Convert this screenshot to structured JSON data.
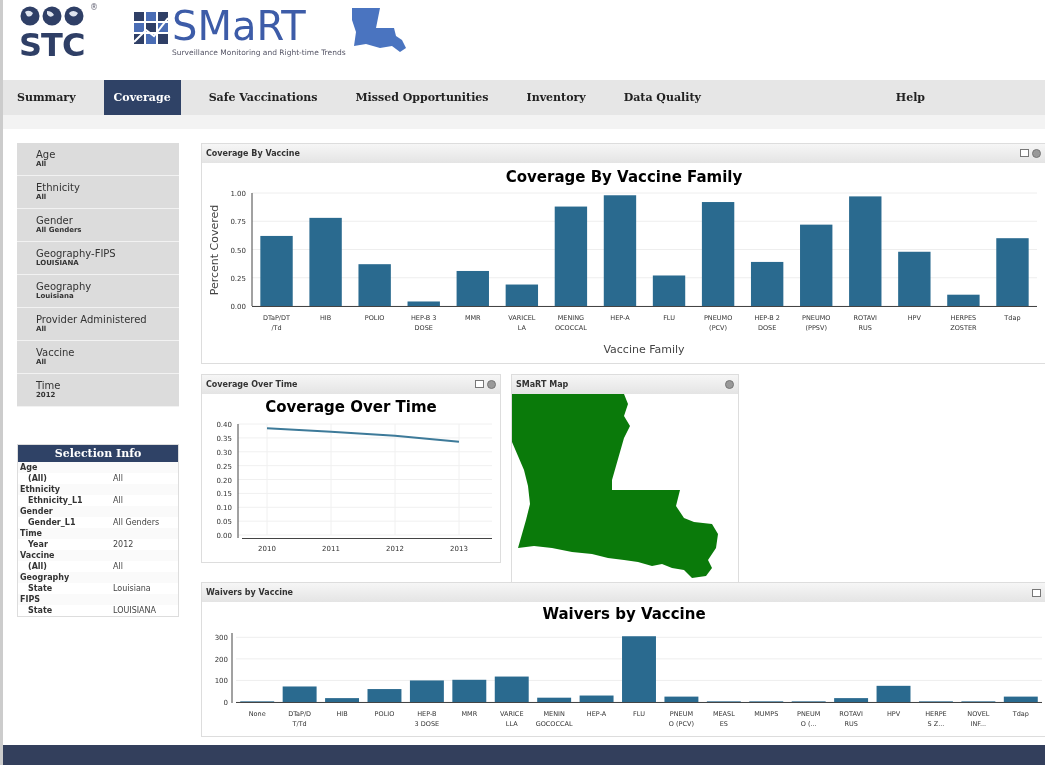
{
  "header": {
    "stc_logo": "STC",
    "registered_mark": "®",
    "smart_logo": "SMaRT",
    "tagline": "Surveillance Monitoring and Right-time Trends"
  },
  "nav": [
    {
      "label": "Summary",
      "selected": false
    },
    {
      "label": "Coverage",
      "selected": true
    },
    {
      "label": "Safe Vaccinations",
      "selected": false
    },
    {
      "label": "Missed Opportunities",
      "selected": false
    },
    {
      "label": "Inventory",
      "selected": false
    },
    {
      "label": "Data Quality",
      "selected": false
    },
    {
      "label": "Help",
      "selected": false
    }
  ],
  "filters": [
    {
      "label": "Age",
      "value": "All"
    },
    {
      "label": "Ethnicity",
      "value": "All"
    },
    {
      "label": "Gender",
      "value": "All Genders"
    },
    {
      "label": "Geography-FIPS",
      "value": "LOUISIANA"
    },
    {
      "label": "Geography",
      "value": "Louisiana"
    },
    {
      "label": "Provider Administered",
      "value": "All"
    },
    {
      "label": "Vaccine",
      "value": "All"
    },
    {
      "label": "Time",
      "value": "2012"
    }
  ],
  "selection_info": {
    "title": "Selection Info",
    "groups": [
      {
        "name": "Age",
        "rows": [
          {
            "key": "(All)",
            "value": "All"
          }
        ]
      },
      {
        "name": "Ethnicity",
        "rows": [
          {
            "key": "Ethnicity_L1",
            "value": "All"
          }
        ]
      },
      {
        "name": "Gender",
        "rows": [
          {
            "key": "Gender_L1",
            "value": "All Genders"
          }
        ]
      },
      {
        "name": "Time",
        "rows": [
          {
            "key": "Year",
            "value": "2012"
          }
        ]
      },
      {
        "name": "Vaccine",
        "rows": [
          {
            "key": "(All)",
            "value": "All"
          }
        ]
      },
      {
        "name": "Geography",
        "rows": [
          {
            "key": "State",
            "value": "Louisiana"
          }
        ]
      },
      {
        "name": "FIPS",
        "rows": [
          {
            "key": "State",
            "value": "LOUISIANA"
          }
        ]
      }
    ]
  },
  "coverage_panel": {
    "title": "Coverage By Vaccine",
    "chart_data": {
      "type": "bar",
      "title": "Coverage By Vaccine Family",
      "xlabel": "Vaccine Family",
      "ylabel": "Percent Covered",
      "categories": [
        "DTaP/DT\n/Td",
        "HIB",
        "POLIO",
        "HEP-B 3\nDOSE",
        "MMR",
        "VARICEL\nLA",
        "MENING\nOCOCCAL",
        "HEP-A",
        "FLU",
        "PNEUMO\n(PCV)",
        "HEP-B 2\nDOSE",
        "PNEUMO\n(PPSV)",
        "ROTAVI\nRUS",
        "HPV",
        "HERPES\nZOSTER",
        "Tdap"
      ],
      "grid": true,
      "series": [
        {
          "color": "#2a6a8f",
          "values": [
            0.62,
            0.78,
            0.37,
            0.04,
            0.31,
            0.19,
            0.88,
            0.98,
            0.27,
            0.92,
            0.39,
            0.72,
            0.97,
            0.48,
            0.1,
            0.6
          ]
        }
      ],
      "ylim": [
        0,
        1
      ],
      "yticks": [
        {
          "value": 0,
          "label": "0.00"
        },
        {
          "value": 0.25,
          "label": "0.25"
        },
        {
          "value": 0.5,
          "label": "0.50"
        },
        {
          "value": 0.75,
          "label": "0.75"
        },
        {
          "value": 1,
          "label": "1.00"
        }
      ]
    }
  },
  "time_panel": {
    "title": "Coverage Over Time",
    "chart_data": {
      "type": "line",
      "title": "Coverage Over Time",
      "x": [
        "2010",
        "2011",
        "2012",
        "2013"
      ],
      "grid": true,
      "series": [
        {
          "color": "#3d7a99",
          "values": [
            0.385,
            0.372,
            0.358,
            0.336
          ]
        }
      ],
      "ylim": [
        0,
        0.4
      ],
      "yticks": [
        {
          "value": 0,
          "label": "0.00"
        },
        {
          "value": 0.05,
          "label": "0.05"
        },
        {
          "value": 0.1,
          "label": "0.10"
        },
        {
          "value": 0.15,
          "label": "0.15"
        },
        {
          "value": 0.2,
          "label": "0.20"
        },
        {
          "value": 0.25,
          "label": "0.25"
        },
        {
          "value": 0.3,
          "label": "0.30"
        },
        {
          "value": 0.35,
          "label": "0.35"
        },
        {
          "value": 0.4,
          "label": "0.40"
        }
      ]
    }
  },
  "map_panel": {
    "title": "SMaRT Map"
  },
  "waivers_panel": {
    "title": "Waivers by Vaccine",
    "chart_data": {
      "type": "bar",
      "title": "Waivers by Vaccine",
      "categories": [
        "None",
        "DTaP/D\nT/Td",
        "HIB",
        "POLIO",
        "HEP-B\n3 DOSE",
        "MMR",
        "VARICE\nLLA",
        "MENIN\nGOCOCCAL",
        "HEP-A",
        "FLU",
        "PNEUM\nO (PCV)",
        "MEASL\nES",
        "MUMPS",
        "PNEUM\nO (...",
        "ROTAVI\nRUS",
        "HPV",
        "HERPE\nS Z...",
        "NOVEL\nINF...",
        "Tdap"
      ],
      "grid": true,
      "series": [
        {
          "color": "#2a6a8f",
          "values": [
            3,
            72,
            18,
            60,
            100,
            103,
            118,
            20,
            30,
            305,
            25,
            3,
            3,
            3,
            18,
            75,
            3,
            3,
            25
          ]
        }
      ],
      "ylim": [
        0,
        320
      ],
      "yticks": [
        0,
        100,
        200,
        300
      ]
    }
  }
}
